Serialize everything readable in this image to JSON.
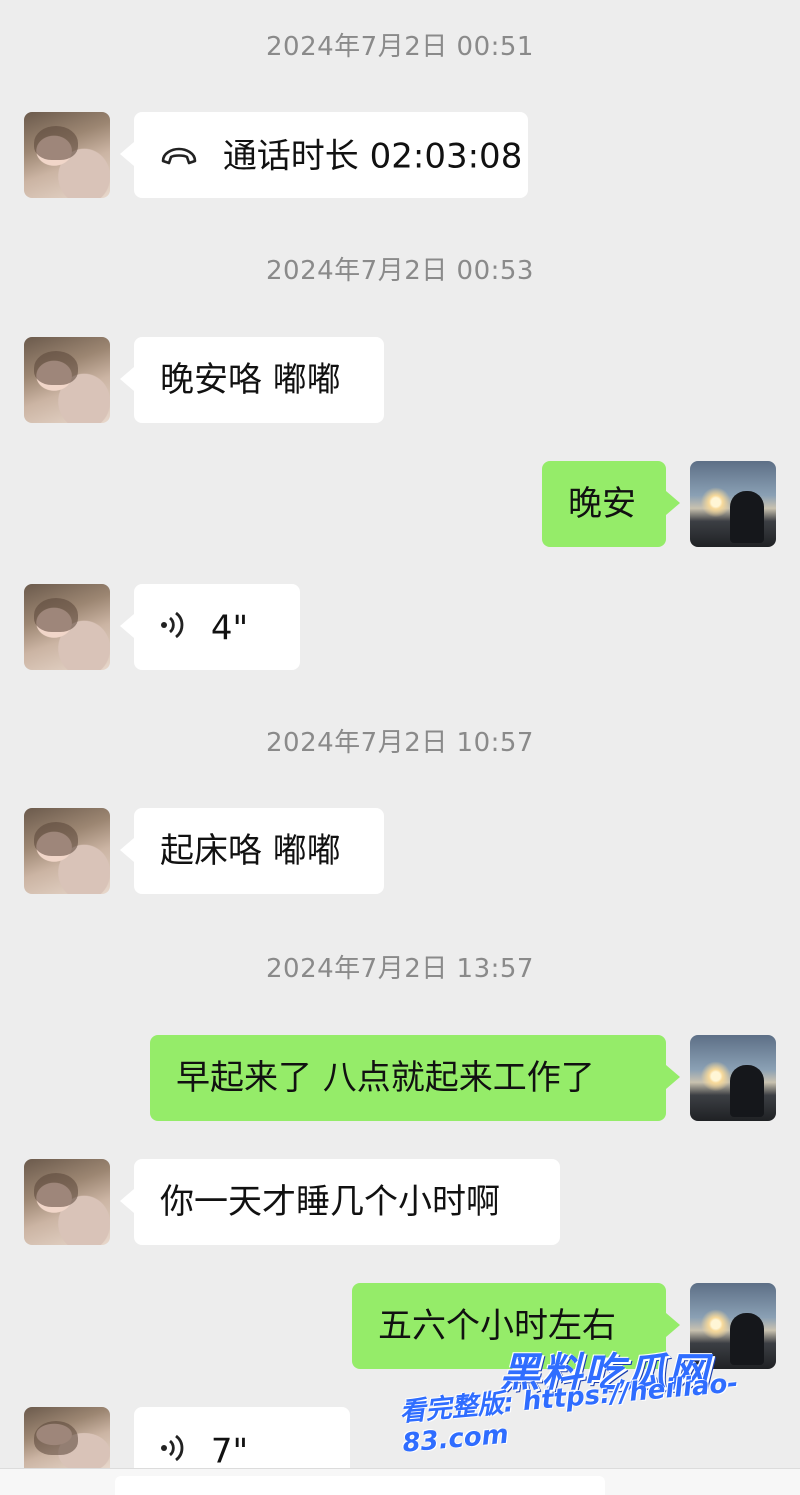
{
  "messages": [
    {
      "type": "timestamp",
      "text": "2024年7月2日  00:51"
    },
    {
      "type": "call",
      "side": "in",
      "text": "通话时长 02:03:08",
      "icon": "phone-hangup-icon"
    },
    {
      "type": "timestamp",
      "text": "2024年7月2日  00:53"
    },
    {
      "type": "text",
      "side": "in",
      "text": "晚安咯 嘟嘟"
    },
    {
      "type": "text",
      "side": "out",
      "text": "晚安"
    },
    {
      "type": "voice",
      "side": "in",
      "text": "4\"",
      "icon": "voice-wave-icon"
    },
    {
      "type": "timestamp",
      "text": "2024年7月2日  10:57"
    },
    {
      "type": "text",
      "side": "in",
      "text": "起床咯 嘟嘟"
    },
    {
      "type": "timestamp",
      "text": "2024年7月2日  13:57"
    },
    {
      "type": "text",
      "side": "out",
      "text": "早起来了 八点就起来工作了"
    },
    {
      "type": "text",
      "side": "in",
      "text": "你一天才睡几个小时啊"
    },
    {
      "type": "text",
      "side": "out",
      "text": "五六个小时左右"
    },
    {
      "type": "voice",
      "side": "in",
      "text": "7\"",
      "icon": "voice-wave-icon"
    }
  ],
  "watermark": {
    "logo": "黑料吃瓜网",
    "url": "看完整版: https://heiliao-83.com"
  },
  "colors": {
    "background": "#ededed",
    "incoming_bubble": "#ffffff",
    "outgoing_bubble": "#95ec69",
    "timestamp_text": "#8a8a8a"
  }
}
